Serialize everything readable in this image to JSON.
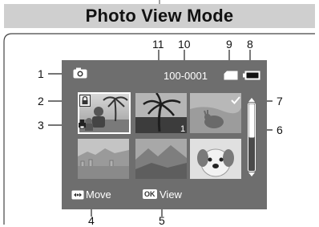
{
  "title": "Photo View Mode",
  "screen": {
    "file_number": "100-0001",
    "counter_badge": "1",
    "move_hint": "Move",
    "view_hint": "View",
    "ok_key": "OK"
  },
  "callouts": [
    "1",
    "2",
    "3",
    "4",
    "5",
    "6",
    "7",
    "8",
    "9",
    "10",
    "11"
  ],
  "icons": [
    "photo-mode-icon",
    "protect-lock-icon",
    "dpof-print-icon",
    "battery-icon",
    "memory-card-icon",
    "delete-check-icon",
    "joystick-icon"
  ],
  "colors": {
    "title_bar": "#cfcfcf",
    "screen_bg": "#6e6e6e",
    "selection_border": "#ffffff"
  }
}
